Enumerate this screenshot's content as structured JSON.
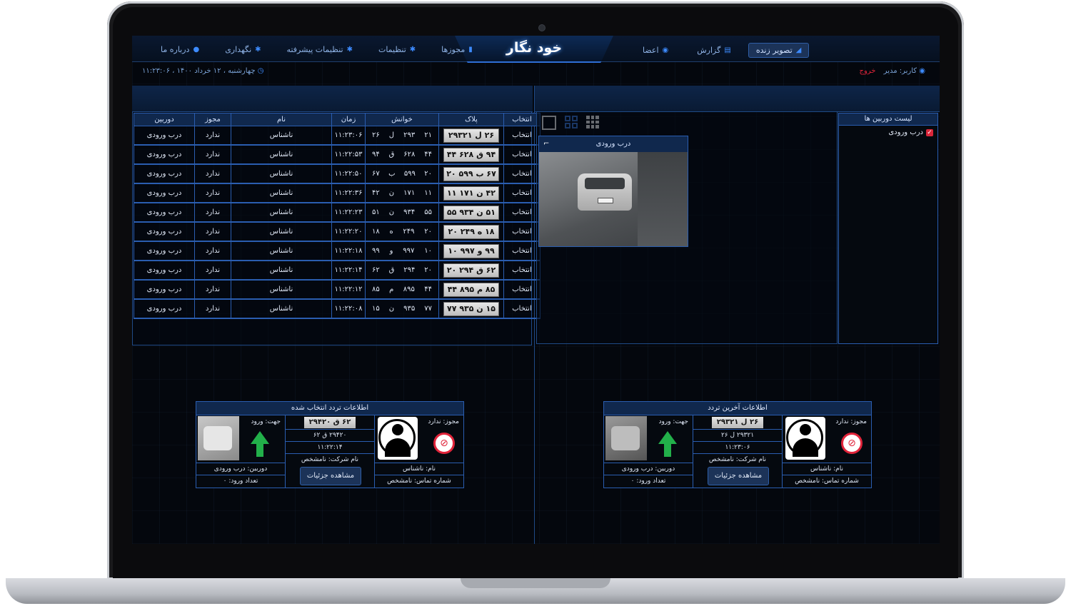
{
  "app": {
    "logo": "خود نگار"
  },
  "nav_right": [
    {
      "label": "تصویر زنده",
      "icon": "camera-icon",
      "active": true
    },
    {
      "label": "گزارش",
      "icon": "report-icon"
    },
    {
      "label": "اعضا",
      "icon": "members-icon"
    }
  ],
  "nav_left": [
    {
      "label": "مجوزها",
      "icon": "lock-icon"
    },
    {
      "label": "تنظیمات",
      "icon": "gear-icon"
    },
    {
      "label": "تنظیمات پیشرفته",
      "icon": "gear-icon"
    },
    {
      "label": "نگهداری",
      "icon": "gear-icon"
    },
    {
      "label": "درباره ما",
      "icon": "info-icon"
    }
  ],
  "status": {
    "user": "کاربر: مدیر",
    "logout": "خروج",
    "datetime": "چهارشنبه ، ۱۲ خرداد ۱۴۰۰ ، ۱۱:۲۳:۰۶"
  },
  "table": {
    "headers": [
      "انتخاب",
      "پلاک",
      "خوانش",
      "زمان",
      "نام",
      "مجوز",
      "دوربین"
    ],
    "rows": [
      {
        "select": "انتخاب",
        "plate": "۲۶ ل ۲۹۳۲۱",
        "r1": "۲۱",
        "r2": "۲۹۳",
        "r3": "ل",
        "r4": "۲۶",
        "time": "۱۱:۲۳:۰۶",
        "name": "ناشناس",
        "permit": "ندارد",
        "camera": "درب ورودی"
      },
      {
        "select": "انتخاب",
        "plate": "۹۴ ق ۶۲۸ ۴۴",
        "r1": "۴۴",
        "r2": "۶۲۸",
        "r3": "ق",
        "r4": "۹۴",
        "time": "۱۱:۲۲:۵۳",
        "name": "ناشناس",
        "permit": "ندارد",
        "camera": "درب ورودی"
      },
      {
        "select": "انتخاب",
        "plate": "۶۷ ب ۵۹۹ ۲۰",
        "r1": "۲۰",
        "r2": "۵۹۹",
        "r3": "ب",
        "r4": "۶۷",
        "time": "۱۱:۲۲:۵۰",
        "name": "ناشناس",
        "permit": "ندارد",
        "camera": "درب ورودی"
      },
      {
        "select": "انتخاب",
        "plate": "۴۲ ن ۱۷۱ ۱۱",
        "r1": "۱۱",
        "r2": "۱۷۱",
        "r3": "ن",
        "r4": "۴۲",
        "time": "۱۱:۲۲:۳۶",
        "name": "ناشناس",
        "permit": "ندارد",
        "camera": "درب ورودی"
      },
      {
        "select": "انتخاب",
        "plate": "۵۱ ن ۹۳۴ ۵۵",
        "r1": "۵۵",
        "r2": "۹۳۴",
        "r3": "ن",
        "r4": "۵۱",
        "time": "۱۱:۲۲:۲۳",
        "name": "ناشناس",
        "permit": "ندارد",
        "camera": "درب ورودی"
      },
      {
        "select": "انتخاب",
        "plate": "۱۸ ه ۲۴۹ ۲۰",
        "r1": "۲۰",
        "r2": "۲۴۹",
        "r3": "ه",
        "r4": "۱۸",
        "time": "۱۱:۲۲:۲۰",
        "name": "ناشناس",
        "permit": "ندارد",
        "camera": "درب ورودی"
      },
      {
        "select": "انتخاب",
        "plate": "۹۹ و ۹۹۷ ۱۰",
        "r1": "۱۰",
        "r2": "۹۹۷",
        "r3": "و",
        "r4": "۹۹",
        "time": "۱۱:۲۲:۱۸",
        "name": "ناشناس",
        "permit": "ندارد",
        "camera": "درب ورودی"
      },
      {
        "select": "انتخاب",
        "plate": "۶۲ ق ۲۹۴ ۲۰",
        "r1": "۲۰",
        "r2": "۲۹۴",
        "r3": "ق",
        "r4": "۶۲",
        "time": "۱۱:۲۲:۱۴",
        "name": "ناشناس",
        "permit": "ندارد",
        "camera": "درب ورودی"
      },
      {
        "select": "انتخاب",
        "plate": "۸۵ م ۸۹۵ ۴۴",
        "r1": "۴۴",
        "r2": "۸۹۵",
        "r3": "م",
        "r4": "۸۵",
        "time": "۱۱:۲۲:۱۲",
        "name": "ناشناس",
        "permit": "ندارد",
        "camera": "درب ورودی"
      },
      {
        "select": "انتخاب",
        "plate": "۱۵ ن ۹۳۵ ۷۷",
        "r1": "۷۷",
        "r2": "۹۳۵",
        "r3": "ن",
        "r4": "۱۵",
        "time": "۱۱:۲۲:۰۸",
        "name": "ناشناس",
        "permit": "ندارد",
        "camera": "درب ورودی"
      }
    ]
  },
  "camera_list": {
    "title": "لیست دوربین ها",
    "items": [
      {
        "label": "درب ورودی",
        "checked": true
      }
    ]
  },
  "camera_tile": {
    "title": "درب ورودی"
  },
  "last_entry": {
    "title": "اطلاعات آخرین تردد",
    "permit": "مجوز: ندارد",
    "name": "نام: ناشناس",
    "phone": "شماره تماس: نامشخص",
    "plate": "۲۶ ل ۲۹۳۲۱",
    "reading": "۲۹۳۲۱ ل ۲۶",
    "time": "۱۱:۲۳:۰۶",
    "company": "نام شرکت: نامشخص",
    "details": "مشاهده جزئیات",
    "direction": "جهت: ورود",
    "camera": "دوربین: درب ورودی",
    "count": "تعداد ورود: ۰"
  },
  "selected_entry": {
    "title": "اطلاعات تردد انتخاب شده",
    "permit": "مجوز: ندارد",
    "name": "نام: ناشناس",
    "phone": "شماره تماس: نامشخص",
    "plate": "۶۲ ق ۲۹۴۲۰",
    "reading": "۲۹۴۲۰ ق ۶۲",
    "time": "۱۱:۲۲:۱۴",
    "company": "نام شرکت: نامشخص",
    "details": "مشاهده جزئیات",
    "direction": "جهت: ورود",
    "camera": "دوربین: درب ورودی",
    "count": "تعداد ورود: ۰"
  },
  "colors": {
    "accent": "#2a5db0",
    "header": "#10284d",
    "active_nav": "#1c3358",
    "ok": "#22b04a",
    "deny": "#e0243a"
  }
}
